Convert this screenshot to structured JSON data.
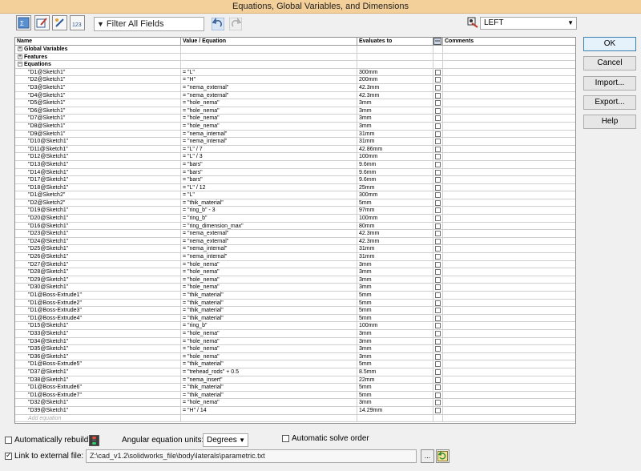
{
  "window": {
    "title": "Equations, Global Variables, and Dimensions"
  },
  "toolbar": {
    "filter_placeholder": "Filter All Fields",
    "icons": [
      "equation-view-icon",
      "sketch-equation-view-icon",
      "dimension-view-icon",
      "ordered-view-icon",
      "undo-icon",
      "redo-icon",
      "units-config-icon"
    ],
    "units_value": "LEFT"
  },
  "table": {
    "headers": {
      "name": "Name",
      "value": "Value / Equation",
      "evaluates": "Evaluates to",
      "comments": "Comments"
    },
    "sections": {
      "global": "Global Variables",
      "features": "Features",
      "equations": "Equations"
    },
    "rows": [
      {
        "name": "\"D1@Sketch1\"",
        "value": "= \"L\"",
        "evaluates": "300mm"
      },
      {
        "name": "\"D2@Sketch1\"",
        "value": "= \"H\"",
        "evaluates": "200mm"
      },
      {
        "name": "\"D3@Sketch1\"",
        "value": "= \"nema_external\"",
        "evaluates": "42.3mm"
      },
      {
        "name": "\"D4@Sketch1\"",
        "value": "= \"nema_external\"",
        "evaluates": "42.3mm"
      },
      {
        "name": "\"D5@Sketch1\"",
        "value": "= \"hole_nema\"",
        "evaluates": "3mm"
      },
      {
        "name": "\"D6@Sketch1\"",
        "value": "= \"hole_nema\"",
        "evaluates": "3mm"
      },
      {
        "name": "\"D7@Sketch1\"",
        "value": "= \"hole_nema\"",
        "evaluates": "3mm"
      },
      {
        "name": "\"D8@Sketch1\"",
        "value": "= \"hole_nema\"",
        "evaluates": "3mm"
      },
      {
        "name": "\"D9@Sketch1\"",
        "value": "= \"nema_internal\"",
        "evaluates": "31mm"
      },
      {
        "name": "\"D10@Sketch1\"",
        "value": "= \"nema_internal\"",
        "evaluates": "31mm"
      },
      {
        "name": "\"D11@Sketch1\"",
        "value": "= \"L\" / 7",
        "evaluates": "42.86mm"
      },
      {
        "name": "\"D12@Sketch1\"",
        "value": "= \"L\" / 3",
        "evaluates": "100mm"
      },
      {
        "name": "\"D13@Sketch1\"",
        "value": "= \"bars\"",
        "evaluates": "9.6mm"
      },
      {
        "name": "\"D14@Sketch1\"",
        "value": "= \"bars\"",
        "evaluates": "9.6mm"
      },
      {
        "name": "\"D17@Sketch1\"",
        "value": "= \"bars\"",
        "evaluates": "9.6mm"
      },
      {
        "name": "\"D18@Sketch1\"",
        "value": "= \"L\" / 12",
        "evaluates": "25mm"
      },
      {
        "name": "\"D1@Sketch2\"",
        "value": "= \"L\"",
        "evaluates": "300mm"
      },
      {
        "name": "\"D2@Sketch2\"",
        "value": "= \"thik_material\"",
        "evaluates": "5mm"
      },
      {
        "name": "\"D19@Sketch1\"",
        "value": "= \"ring_b\" - 3",
        "evaluates": "97mm"
      },
      {
        "name": "\"D20@Sketch1\"",
        "value": "= \"ring_b\"",
        "evaluates": "100mm"
      },
      {
        "name": "\"D16@Sketch1\"",
        "value": "= \"ring_dimension_max\"",
        "evaluates": "80mm"
      },
      {
        "name": "\"D23@Sketch1\"",
        "value": "= \"nema_external\"",
        "evaluates": "42.3mm"
      },
      {
        "name": "\"D24@Sketch1\"",
        "value": "= \"nema_external\"",
        "evaluates": "42.3mm"
      },
      {
        "name": "\"D25@Sketch1\"",
        "value": "= \"nema_internal\"",
        "evaluates": "31mm"
      },
      {
        "name": "\"D26@Sketch1\"",
        "value": "= \"nema_internal\"",
        "evaluates": "31mm"
      },
      {
        "name": "\"D27@Sketch1\"",
        "value": "= \"hole_nema\"",
        "evaluates": "3mm"
      },
      {
        "name": "\"D28@Sketch1\"",
        "value": "= \"hole_nema\"",
        "evaluates": "3mm"
      },
      {
        "name": "\"D29@Sketch1\"",
        "value": "= \"hole_nema\"",
        "evaluates": "3mm"
      },
      {
        "name": "\"D30@Sketch1\"",
        "value": "= \"hole_nema\"",
        "evaluates": "3mm"
      },
      {
        "name": "\"D1@Boss-Extrude1\"",
        "value": "= \"thik_material\"",
        "evaluates": "5mm"
      },
      {
        "name": "\"D1@Boss-Extrude2\"",
        "value": "= \"thik_material\"",
        "evaluates": "5mm"
      },
      {
        "name": "\"D1@Boss-Extrude3\"",
        "value": "= \"thik_material\"",
        "evaluates": "5mm"
      },
      {
        "name": "\"D1@Boss-Extrude4\"",
        "value": "= \"thik_material\"",
        "evaluates": "5mm"
      },
      {
        "name": "\"D15@Sketch1\"",
        "value": "= \"ring_b\"",
        "evaluates": "100mm"
      },
      {
        "name": "\"D33@Sketch1\"",
        "value": "= \"hole_nema\"",
        "evaluates": "3mm"
      },
      {
        "name": "\"D34@Sketch1\"",
        "value": "= \"hole_nema\"",
        "evaluates": "3mm"
      },
      {
        "name": "\"D35@Sketch1\"",
        "value": "= \"hole_nema\"",
        "evaluates": "3mm"
      },
      {
        "name": "\"D36@Sketch1\"",
        "value": "= \"hole_nema\"",
        "evaluates": "3mm"
      },
      {
        "name": "\"D1@Boss-Extrude5\"",
        "value": "= \"thik_material\"",
        "evaluates": "5mm"
      },
      {
        "name": "\"D37@Sketch1\"",
        "value": "= \"trehead_rods\" + 0.5",
        "evaluates": "8.5mm"
      },
      {
        "name": "\"D38@Sketch1\"",
        "value": "= \"nema_insert\"",
        "evaluates": "22mm"
      },
      {
        "name": "\"D1@Boss-Extrude6\"",
        "value": "= \"thik_material\"",
        "evaluates": "5mm"
      },
      {
        "name": "\"D1@Boss-Extrude7\"",
        "value": "= \"thik_material\"",
        "evaluates": "5mm"
      },
      {
        "name": "\"D32@Sketch1\"",
        "value": "= \"hole_nema\"",
        "evaluates": "3mm"
      },
      {
        "name": "\"D39@Sketch1\"",
        "value": "= \"H\" / 14",
        "evaluates": "14.29mm"
      }
    ],
    "add_equation_placeholder": "Add equation"
  },
  "buttons": {
    "ok": "OK",
    "cancel": "Cancel",
    "import": "Import...",
    "export": "Export...",
    "help": "Help"
  },
  "bottom": {
    "auto_rebuild": "Automatically rebuild",
    "angular_units_label": "Angular equation units:",
    "angular_units_value": "Degrees",
    "auto_solve": "Automatic solve order",
    "link_label": "Link to external file:",
    "link_path": "Z:\\cad_v1.2\\solidworks_file\\body\\laterals\\parametric.txt",
    "browse_label": "..."
  },
  "colors": {
    "title_bar": "#f3d09a",
    "ok_border": "#3c7fb1"
  }
}
